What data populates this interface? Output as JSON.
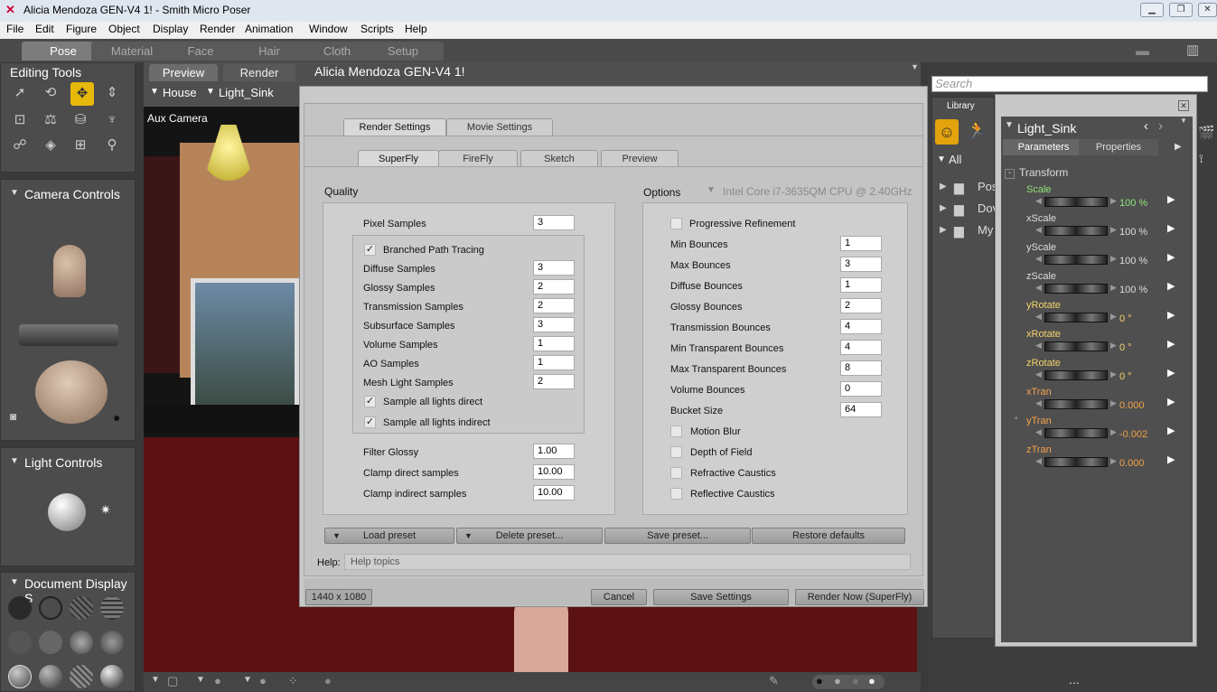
{
  "window": {
    "title": "Alicia Mendoza GEN-V4 1! - Smith Micro Poser"
  },
  "menu": [
    "File",
    "Edit",
    "Figure",
    "Object",
    "Display",
    "Render",
    "Animation",
    "Window",
    "Scripts",
    "Help"
  ],
  "rooms": [
    "Pose",
    "Material",
    "Face",
    "Hair",
    "Cloth",
    "Setup"
  ],
  "active_room": "Pose",
  "left": {
    "editing_tools": "Editing Tools",
    "camera_controls": "Camera Controls",
    "light_controls": "Light Controls",
    "document_display": "Document Display S"
  },
  "doc_tabs": [
    "Preview",
    "Render"
  ],
  "doc_title": "Alicia Mendoza GEN-V4 1!",
  "selectors": {
    "figure": "House",
    "actor": "Light_Sink"
  },
  "camera_label": "Aux Camera",
  "dialog": {
    "top_tabs": [
      "Render Settings",
      "Movie Settings"
    ],
    "engine_tabs": [
      "SuperFly",
      "FireFly",
      "Sketch",
      "Preview"
    ],
    "quality": {
      "title": "Quality",
      "pixel_samples": {
        "label": "Pixel Samples",
        "value": "3"
      },
      "branched_path": {
        "label": "Branched Path Tracing",
        "checked": "✓"
      },
      "rows": [
        {
          "label": "Diffuse Samples",
          "value": "3"
        },
        {
          "label": "Glossy Samples",
          "value": "2"
        },
        {
          "label": "Transmission Samples",
          "value": "2"
        },
        {
          "label": "Subsurface Samples",
          "value": "3"
        },
        {
          "label": "Volume Samples",
          "value": "1"
        },
        {
          "label": "AO Samples",
          "value": "1"
        },
        {
          "label": "Mesh Light Samples",
          "value": "2"
        }
      ],
      "sample_direct": {
        "label": "Sample all lights direct",
        "checked": "✓"
      },
      "sample_indirect": {
        "label": "Sample all lights indirect",
        "checked": "✓"
      },
      "filter_glossy": {
        "label": "Filter Glossy",
        "value": "1.00"
      },
      "clamp_direct": {
        "label": "Clamp direct samples",
        "value": "10.00"
      },
      "clamp_indirect": {
        "label": "Clamp indirect samples",
        "value": "10.00"
      }
    },
    "options": {
      "title": "Options",
      "device": "Intel Core i7-3635QM CPU @ 2.40GHz",
      "progressive": "Progressive Refinement",
      "rows": [
        {
          "label": "Min Bounces",
          "value": "1"
        },
        {
          "label": "Max Bounces",
          "value": "3"
        },
        {
          "label": "Diffuse Bounces",
          "value": "1"
        },
        {
          "label": "Glossy Bounces",
          "value": "2"
        },
        {
          "label": "Transmission Bounces",
          "value": "4"
        },
        {
          "label": "Min Transparent Bounces",
          "value": "4"
        },
        {
          "label": "Max Transparent Bounces",
          "value": "8"
        },
        {
          "label": "Volume Bounces",
          "value": "0"
        },
        {
          "label": "Bucket Size",
          "value": "64"
        }
      ],
      "checks": [
        "Motion Blur",
        "Depth of Field",
        "Refractive Caustics",
        "Reflective Caustics"
      ]
    },
    "presets": {
      "load": "Load preset",
      "delete": "Delete preset...",
      "save": "Save preset...",
      "restore": "Restore defaults"
    },
    "help_label": "Help:",
    "help_text": "Help topics",
    "resolution": "1440 x 1080",
    "cancel": "Cancel",
    "save_settings": "Save Settings",
    "render_now": "Render Now (SuperFly)"
  },
  "right": {
    "search_placeholder": "Search",
    "library": "Library",
    "all": "All",
    "folders": [
      "Pos",
      "Dov",
      "My"
    ],
    "actor": "Light_Sink",
    "tabs": [
      "Parameters",
      "Properties"
    ],
    "group": "Transform",
    "params": [
      {
        "name": "Scale",
        "value": "100 %",
        "color": "#8fe27a"
      },
      {
        "name": "xScale",
        "value": "100 %",
        "color": "#dddddd"
      },
      {
        "name": "yScale",
        "value": "100 %",
        "color": "#dddddd"
      },
      {
        "name": "zScale",
        "value": "100 %",
        "color": "#dddddd"
      },
      {
        "name": "yRotate",
        "value": "0 °",
        "color": "#f3d36a"
      },
      {
        "name": "xRotate",
        "value": "0 °",
        "color": "#f3d36a"
      },
      {
        "name": "zRotate",
        "value": "0 °",
        "color": "#f3d36a"
      },
      {
        "name": "xTran",
        "value": "0.000",
        "color": "#f3a24a"
      },
      {
        "name": "yTran",
        "value": "-0.002",
        "color": "#f3a24a"
      },
      {
        "name": "zTran",
        "value": "0.000",
        "color": "#f3a24a"
      }
    ]
  },
  "bottom_dots": "..."
}
